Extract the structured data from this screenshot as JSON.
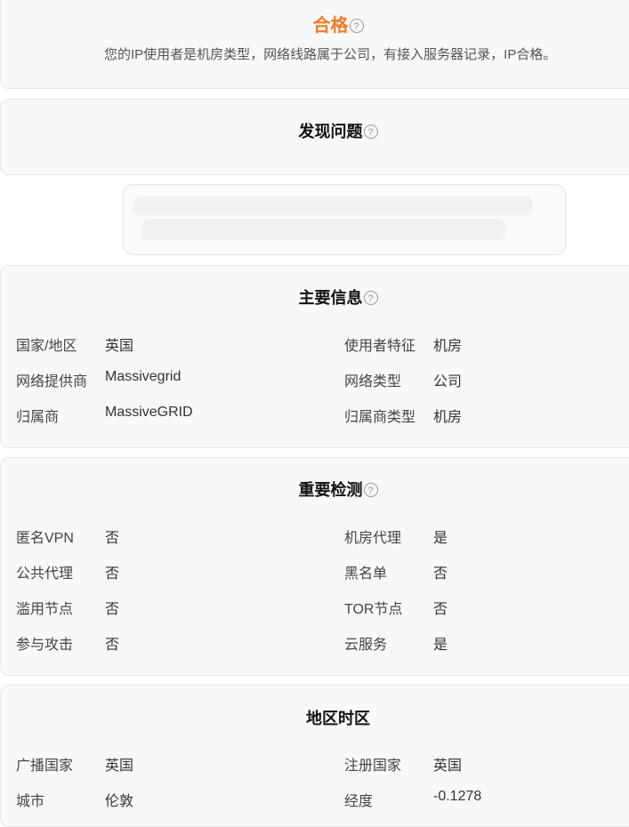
{
  "verdict": {
    "title": "合格",
    "description": "您的IP使用者是机房类型，网络线路属于公司，有接入服务器记录，IP合格。"
  },
  "issues": {
    "title": "发现问题"
  },
  "main_info": {
    "title": "主要信息",
    "left": [
      {
        "label": "国家/地区",
        "value": "英国"
      },
      {
        "label": "网络提供商",
        "value": "Massivegrid"
      },
      {
        "label": "归属商",
        "value": "MassiveGRID"
      }
    ],
    "right": [
      {
        "label": "使用者特征",
        "value": "机房"
      },
      {
        "label": "网络类型",
        "value": "公司"
      },
      {
        "label": "归属商类型",
        "value": "机房"
      }
    ]
  },
  "checks": {
    "title": "重要检测",
    "left": [
      {
        "label": "匿名VPN",
        "value": "否"
      },
      {
        "label": "公共代理",
        "value": "否"
      },
      {
        "label": "滥用节点",
        "value": "否"
      },
      {
        "label": "参与攻击",
        "value": "否"
      }
    ],
    "right": [
      {
        "label": "机房代理",
        "value": "是"
      },
      {
        "label": "黑名单",
        "value": "否"
      },
      {
        "label": "TOR节点",
        "value": "否"
      },
      {
        "label": "云服务",
        "value": "是"
      }
    ]
  },
  "region": {
    "title": "地区时区",
    "left": [
      {
        "label": "广播国家",
        "value": "英国"
      },
      {
        "label": "城市",
        "value": "伦敦"
      }
    ],
    "right": [
      {
        "label": "注册国家",
        "value": "英国"
      },
      {
        "label": "经度",
        "value": "-0.1278"
      }
    ]
  },
  "colors": {
    "accent": "#f07a24",
    "card_bg": "#f8f8f8",
    "border": "#e6e6e6"
  },
  "icons": {
    "help": "question-circle-icon"
  }
}
